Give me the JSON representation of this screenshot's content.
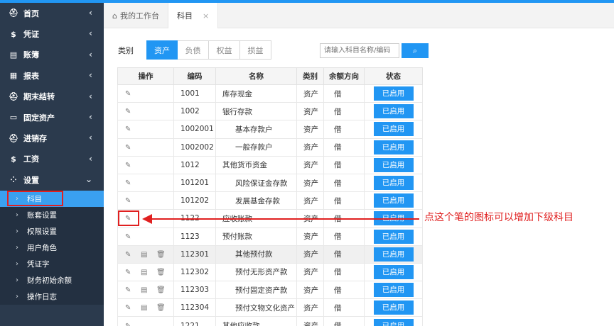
{
  "sidebar": {
    "items": [
      {
        "icon": "⛑",
        "label": "首页",
        "chev": "‹"
      },
      {
        "icon": "$",
        "label": "凭证",
        "chev": "‹"
      },
      {
        "icon": "▤",
        "label": "账簿",
        "chev": "‹"
      },
      {
        "icon": "▦",
        "label": "报表",
        "chev": "‹"
      },
      {
        "icon": "⛑",
        "label": "期末结转",
        "chev": "‹"
      },
      {
        "icon": "▭",
        "label": "固定资产",
        "chev": "‹"
      },
      {
        "icon": "⛑",
        "label": "进销存",
        "chev": "‹"
      },
      {
        "icon": "$",
        "label": "工资",
        "chev": "‹"
      },
      {
        "icon": "⁘",
        "label": "设置",
        "chev": "⌄"
      }
    ],
    "sub_items": [
      {
        "label": "科目",
        "active": true
      },
      {
        "label": "账套设置"
      },
      {
        "label": "权限设置"
      },
      {
        "label": "用户角色"
      },
      {
        "label": "凭证字"
      },
      {
        "label": "财务初始余额"
      },
      {
        "label": "操作日志"
      }
    ]
  },
  "tabs": [
    {
      "icon": "⌂",
      "label": "我的工作台"
    },
    {
      "label": "科目",
      "close": "×"
    }
  ],
  "filter": {
    "label": "类别",
    "categories": [
      "资产",
      "负债",
      "权益",
      "损益"
    ]
  },
  "search": {
    "placeholder": "请输入科目名称/编码",
    "button_icon": "⌕"
  },
  "table": {
    "headers": [
      "操作",
      "编码",
      "名称",
      "类别",
      "余额方向",
      "状态"
    ],
    "rows": [
      {
        "code": "1001",
        "name": "库存现金",
        "cat": "资产",
        "dir": "借",
        "status": "已启用",
        "indent": 0,
        "extra": false
      },
      {
        "code": "1002",
        "name": "银行存款",
        "cat": "资产",
        "dir": "借",
        "status": "已启用",
        "indent": 0,
        "extra": false
      },
      {
        "code": "1002001",
        "name": "基本存款户",
        "cat": "资产",
        "dir": "借",
        "status": "已启用",
        "indent": 1,
        "extra": false
      },
      {
        "code": "1002002",
        "name": "一般存款户",
        "cat": "资产",
        "dir": "借",
        "status": "已启用",
        "indent": 1,
        "extra": false
      },
      {
        "code": "1012",
        "name": "其他货币资金",
        "cat": "资产",
        "dir": "借",
        "status": "已启用",
        "indent": 0,
        "extra": false
      },
      {
        "code": "101201",
        "name": "风险保证金存款",
        "cat": "资产",
        "dir": "借",
        "status": "已启用",
        "indent": 1,
        "extra": false
      },
      {
        "code": "101202",
        "name": "发展基金存款",
        "cat": "资产",
        "dir": "借",
        "status": "已启用",
        "indent": 1,
        "extra": false
      },
      {
        "code": "1122",
        "name": "应收账款",
        "cat": "资产",
        "dir": "借",
        "status": "已启用",
        "indent": 0,
        "extra": false
      },
      {
        "code": "1123",
        "name": "预付账款",
        "cat": "资产",
        "dir": "借",
        "status": "已启用",
        "indent": 0,
        "extra": false
      },
      {
        "code": "112301",
        "name": "其他预付款",
        "cat": "资产",
        "dir": "借",
        "status": "已启用",
        "indent": 1,
        "extra": true,
        "highlight": true
      },
      {
        "code": "112302",
        "name": "预付无形资产款",
        "cat": "资产",
        "dir": "借",
        "status": "已启用",
        "indent": 1,
        "extra": true
      },
      {
        "code": "112303",
        "name": "预付固定资产款",
        "cat": "资产",
        "dir": "借",
        "status": "已启用",
        "indent": 1,
        "extra": true
      },
      {
        "code": "112304",
        "name": "预付文物文化资产",
        "cat": "资产",
        "dir": "借",
        "status": "已启用",
        "indent": 1,
        "extra": true
      },
      {
        "code": "1221",
        "name": "其他应收款",
        "cat": "资产",
        "dir": "借",
        "status": "已启用",
        "indent": 0,
        "extra": false
      }
    ]
  },
  "icons": {
    "edit": "✎",
    "copy": "▤",
    "delete": "🗑"
  },
  "annotation": {
    "text": "点这个笔的图标可以增加下级科目"
  },
  "colors": {
    "accent": "#2196f3",
    "sidebar": "#2b3a4d",
    "annotation": "#e02020"
  }
}
